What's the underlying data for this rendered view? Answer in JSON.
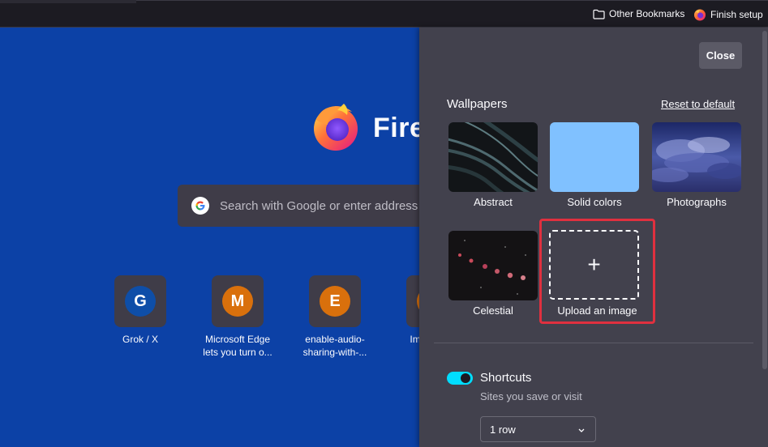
{
  "toolbar": {
    "other_bookmarks": "Other Bookmarks",
    "finish_setup": "Finish setup"
  },
  "newtab": {
    "logo_text": "Fire",
    "search_placeholder": "Search with Google or enter address",
    "shortcuts": [
      {
        "letter": "G",
        "label": "Grok / X",
        "color": "#0e4ea8"
      },
      {
        "letter": "M",
        "label": "Microsoft Edge lets you turn o...",
        "color": "#d9700c"
      },
      {
        "letter": "E",
        "label": "enable-audio-sharing-with-...",
        "color": "#d9700c"
      },
      {
        "letter": "",
        "label": "Imag Tech",
        "color": "#d9700c"
      }
    ]
  },
  "panel": {
    "close_label": "Close",
    "wallpapers_heading": "Wallpapers",
    "reset_label": "Reset to default",
    "wallpapers": [
      {
        "label": "Abstract"
      },
      {
        "label": "Solid colors"
      },
      {
        "label": "Photographs"
      },
      {
        "label": "Celestial"
      }
    ],
    "upload_label": "Upload an image",
    "upload_icon": "+",
    "shortcuts_title": "Shortcuts",
    "shortcuts_subtitle": "Sites you save or visit",
    "rows_value": "1 row"
  },
  "colors": {
    "ntp_background": "#0c41a6",
    "panel_background": "#42414d",
    "toggle_on": "#00ddff",
    "highlight": "#e0303f"
  }
}
